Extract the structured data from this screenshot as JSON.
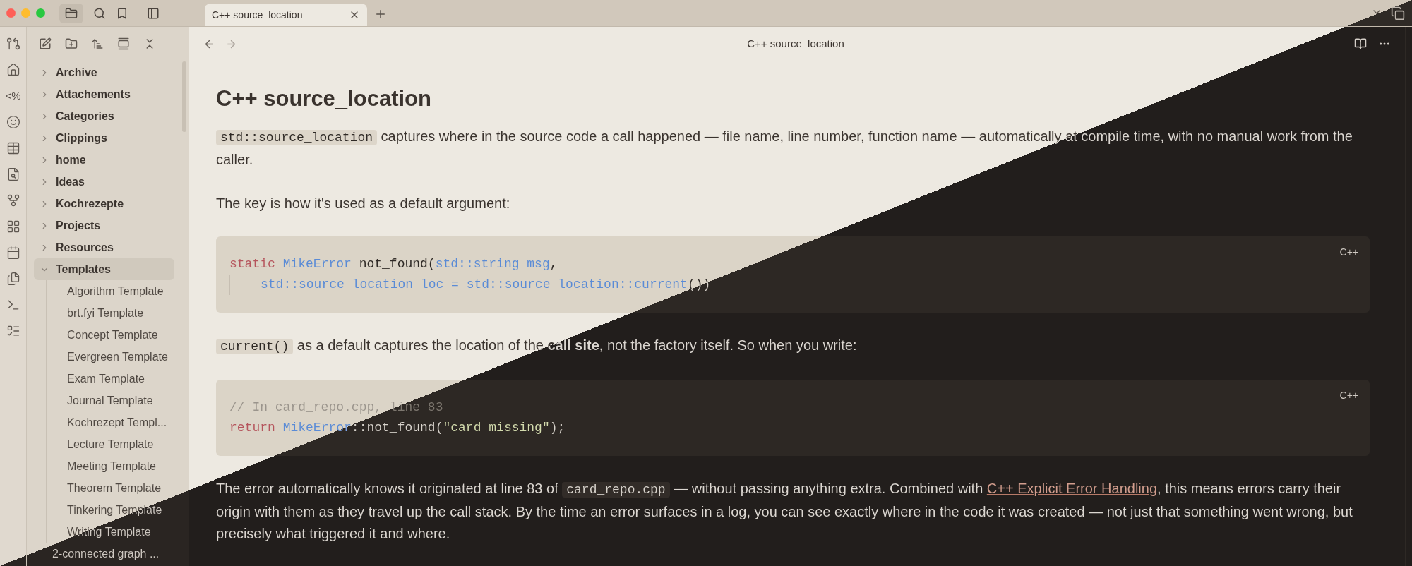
{
  "tab": {
    "title": "C++ source_location",
    "selected": true
  },
  "ribbon": [
    {
      "kind": "icon"
    },
    {
      "kind": "icon"
    },
    {
      "kind": "text",
      "text": "<%"
    },
    {
      "kind": "icon"
    },
    {
      "kind": "icon"
    },
    {
      "kind": "icon"
    },
    {
      "kind": "icon"
    },
    {
      "kind": "icon"
    },
    {
      "kind": "icon"
    },
    {
      "kind": "icon"
    },
    {
      "kind": "icon"
    },
    {
      "kind": "icon"
    }
  ],
  "sidebar": {
    "items": [
      {
        "label": "Archive",
        "kind": "folder",
        "expanded": false,
        "selected": false
      },
      {
        "label": "Attachements",
        "kind": "folder",
        "expanded": false,
        "selected": false
      },
      {
        "label": "Categories",
        "kind": "folder",
        "expanded": false,
        "selected": false
      },
      {
        "label": "Clippings",
        "kind": "folder",
        "expanded": false,
        "selected": false
      },
      {
        "label": "home",
        "kind": "folder",
        "expanded": false,
        "selected": false
      },
      {
        "label": "Ideas",
        "kind": "folder",
        "expanded": false,
        "selected": false
      },
      {
        "label": "Kochrezepte",
        "kind": "folder",
        "expanded": false,
        "selected": false
      },
      {
        "label": "Projects",
        "kind": "folder",
        "expanded": false,
        "selected": false
      },
      {
        "label": "Resources",
        "kind": "folder",
        "expanded": false,
        "selected": false
      },
      {
        "label": "Templates",
        "kind": "folder",
        "expanded": true,
        "selected": true,
        "children": [
          {
            "label": "Algorithm Template",
            "kind": "file",
            "selected": false
          },
          {
            "label": "brt.fyi Template",
            "kind": "file",
            "selected": false
          },
          {
            "label": "Concept Template",
            "kind": "file",
            "selected": false
          },
          {
            "label": "Evergreen Template",
            "kind": "file",
            "selected": false
          },
          {
            "label": "Exam Template",
            "kind": "file",
            "selected": false
          },
          {
            "label": "Journal Template",
            "kind": "file",
            "selected": false
          },
          {
            "label": "Kochrezept Templ...",
            "kind": "file",
            "selected": false
          },
          {
            "label": "Lecture Template",
            "kind": "file",
            "selected": false
          },
          {
            "label": "Meeting Template",
            "kind": "file",
            "selected": false
          },
          {
            "label": "Theorem Template",
            "kind": "file",
            "selected": false
          },
          {
            "label": "Tinkering Template",
            "kind": "file",
            "selected": false
          },
          {
            "label": "Writing Template",
            "kind": "file",
            "selected": false
          }
        ]
      },
      {
        "label": "2-connected graph ...",
        "kind": "file",
        "selected": false
      }
    ]
  },
  "note": {
    "view_title": "C++ source_location",
    "title": "C++ source_location",
    "blocks": [
      {
        "kind": "paragraph",
        "segments": [
          {
            "kind": "code",
            "text": "std::source_location"
          },
          {
            "kind": "text",
            "text": " captures where in the source code a call happened — file name, line number, function name — automatically at compile time, with no manual work from the caller."
          }
        ]
      },
      {
        "kind": "paragraph",
        "segments": [
          {
            "kind": "text",
            "text": "The key is how it's used as a default argument:"
          }
        ]
      },
      {
        "kind": "code_block",
        "language": "C++",
        "lines": [
          {
            "indent": false,
            "tokens": [
              {
                "kind": "keyword",
                "text": "static "
              },
              {
                "kind": "type",
                "text": "MikeError"
              },
              {
                "kind": "plain",
                "text": " not_found("
              },
              {
                "kind": "type",
                "text": "std::string msg"
              },
              {
                "kind": "plain",
                "text": ","
              }
            ]
          },
          {
            "indent": true,
            "tokens": [
              {
                "kind": "type",
                "text": "std::source_location loc = std::source_location::current"
              },
              {
                "kind": "plain",
                "text": "())"
              }
            ]
          }
        ]
      },
      {
        "kind": "paragraph",
        "segments": [
          {
            "kind": "code",
            "text": "current()"
          },
          {
            "kind": "text",
            "text": " as a default captures the location of the **call site**, not the factory itself. So when you write:"
          }
        ]
      },
      {
        "kind": "code_block",
        "language": "C++",
        "lines": [
          {
            "indent": false,
            "tokens": [
              {
                "kind": "comment",
                "text": "// In card_repo.cpp, line 83"
              }
            ]
          },
          {
            "indent": false,
            "tokens": [
              {
                "kind": "keyword",
                "text": "return "
              },
              {
                "kind": "type",
                "text": "MikeError"
              },
              {
                "kind": "plain",
                "text": "::not_found("
              },
              {
                "kind": "string",
                "text": "\"card missing\""
              },
              {
                "kind": "plain",
                "text": ");"
              }
            ]
          }
        ]
      },
      {
        "kind": "paragraph",
        "segments": [
          {
            "kind": "text",
            "text": "The error automatically knows it originated at line 83 of "
          },
          {
            "kind": "code",
            "text": "card_repo.cpp"
          },
          {
            "kind": "text",
            "text": " — without passing anything extra. Combined with "
          },
          {
            "kind": "link",
            "text": "C++ Explicit Error Handling"
          },
          {
            "kind": "text",
            "text": ", this means errors carry their origin with them as they travel up the call stack. By the time an error surfaces in a log, you can see exactly where in the code it was created — not just that something went wrong, but precisely what triggered it and where."
          }
        ]
      }
    ]
  }
}
